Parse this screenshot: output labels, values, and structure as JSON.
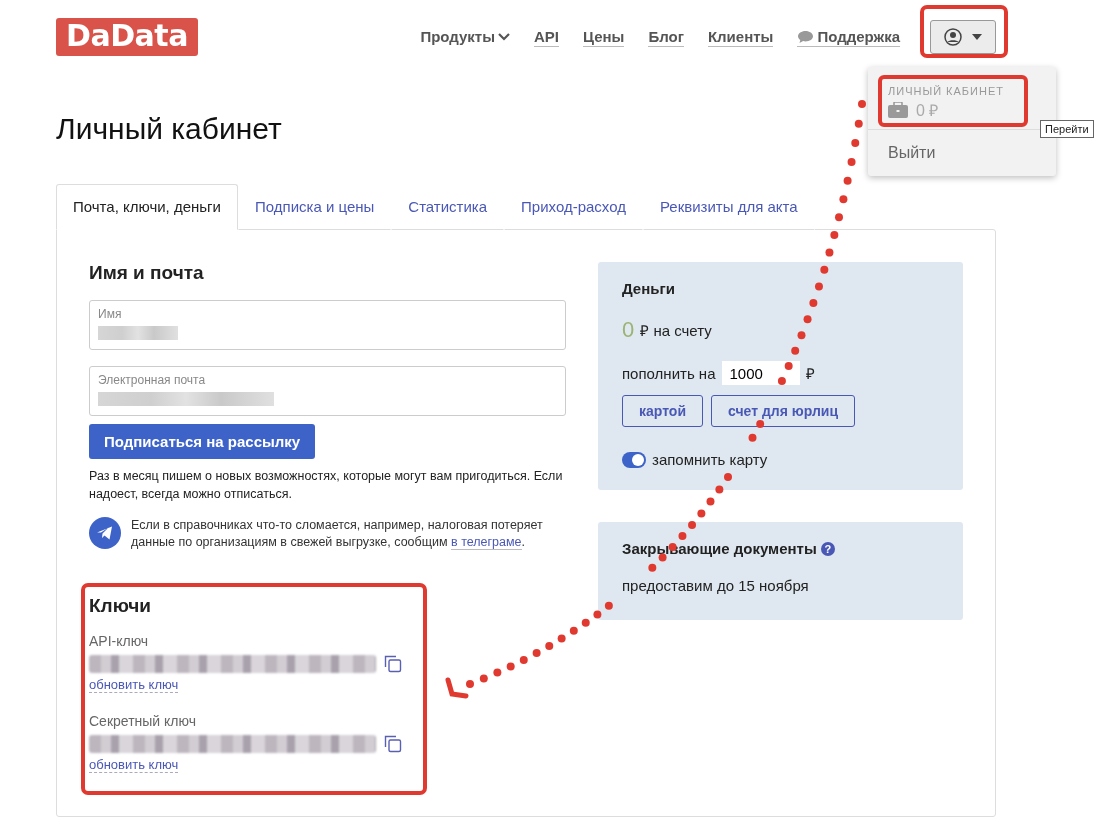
{
  "logo": "DaData",
  "nav": [
    {
      "label": "Продукты",
      "kind": "dropdown"
    },
    {
      "label": "API",
      "kind": "link"
    },
    {
      "label": "Цены",
      "kind": "link"
    },
    {
      "label": "Блог",
      "kind": "link"
    },
    {
      "label": "Клиенты",
      "kind": "link"
    },
    {
      "label": "Поддержка",
      "kind": "chat"
    }
  ],
  "user_menu": {
    "expanded": true,
    "header": "ЛИЧНЫЙ КАБИНЕТ",
    "balance": "0 ₽",
    "logout": "Выйти",
    "tooltip": "Перейти"
  },
  "title": "Личный кабинет",
  "tabs": [
    {
      "label": "Почта, ключи, деньги",
      "selected": true
    },
    {
      "label": "Подписка и цены",
      "selected": false
    },
    {
      "label": "Статистика",
      "selected": false
    },
    {
      "label": "Приход-расход",
      "selected": false
    },
    {
      "label": "Реквизиты для акта",
      "selected": false
    }
  ],
  "profile": {
    "heading": "Имя и почта",
    "fields": [
      {
        "label": "Имя"
      },
      {
        "label": "Электронная почта"
      }
    ],
    "subscribe_button": "Подписаться на рассылку",
    "note": "Раз в месяц пишем о новых возможностях, которые могут вам пригодиться. Если надоест, всегда можно отписаться.",
    "telegram_text": "Если в справочниках что-то сломается, например, налоговая потеряет данные по организациям в свежей выгрузке, сообщим ",
    "telegram_link": "в телеграме",
    "telegram_end": "."
  },
  "keys": {
    "heading": "Ключи",
    "items": [
      {
        "label": "API-ключ",
        "action": "обновить ключ"
      },
      {
        "label": "Секретный ключ",
        "action": "обновить ключ"
      }
    ]
  },
  "money": {
    "heading": "Деньги",
    "amount": "0",
    "balance_text": "₽ на счету",
    "topup_label": "пополнить на",
    "topup_value": "1000",
    "currency": "₽",
    "buttons": [
      "картой",
      "счет для юрлиц"
    ],
    "remember": {
      "label": "запомнить карту",
      "on": true
    }
  },
  "documents": {
    "heading": "Закрывающие документы",
    "help": "?",
    "text": "предоставим до 15 ноября"
  }
}
